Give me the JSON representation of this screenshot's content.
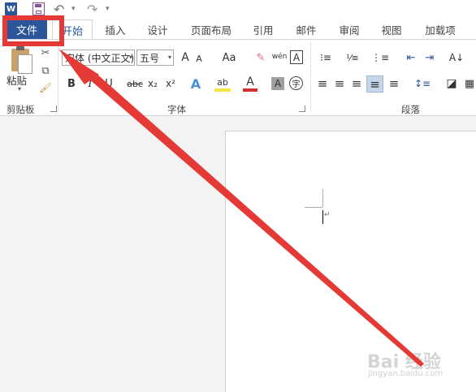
{
  "quick_access": {
    "app_icon": "W",
    "icons": [
      "word-icon",
      "save-icon",
      "undo-icon",
      "redo-icon"
    ],
    "undo_glyph": "↶",
    "redo_glyph": "↷",
    "dropdown_glyph": "▾"
  },
  "tabs": {
    "file": "文件",
    "home": "开始",
    "items": [
      "插入",
      "设计",
      "页面布局",
      "引用",
      "邮件",
      "审阅",
      "视图",
      "加载项"
    ]
  },
  "ribbon": {
    "clipboard": {
      "paste_label": "粘贴",
      "group_label": "剪贴板",
      "cut_glyph": "✂",
      "copy_glyph": "⧉",
      "painter_glyph": "🖌",
      "arrow_glyph": "▾"
    },
    "font": {
      "font_name": "宋体 (中文正文)",
      "font_size": "五号",
      "grow_label": "A",
      "shrink_label": "A",
      "case_label": "Aa",
      "clear_glyph": "✎",
      "pinyin_label": "wén",
      "border_char_label": "A",
      "bold": "B",
      "italic": "I",
      "underline": "U",
      "strike": "abc",
      "subscript": "x₂",
      "superscript": "x²",
      "text_effects": "A",
      "highlight": "ab",
      "font_color": "A",
      "char_shading": "A",
      "enclose_char": "字",
      "group_label": "字体"
    },
    "paragraph": {
      "group_label": "段落",
      "bullets_glyph": "⁝≡",
      "numbering_glyph": "⅟≡",
      "multilevel_glyph": "⋮≡",
      "decrease_indent_glyph": "⇤",
      "increase_indent_glyph": "⇥",
      "sort_glyph": "A↓",
      "align_glyphs": [
        "≡",
        "≡",
        "≡",
        "≡",
        "≡"
      ],
      "line_spacing_glyph": "↕≡",
      "shading_glyph": "◪",
      "borders_glyph": "▦"
    }
  },
  "document": {
    "paragraph_mark": "↵"
  },
  "watermark": {
    "brand": "Bai  经验",
    "url": "jingyan.baidu.com"
  },
  "annotation_color": "#e53935",
  "accent_color": "#2b579a"
}
